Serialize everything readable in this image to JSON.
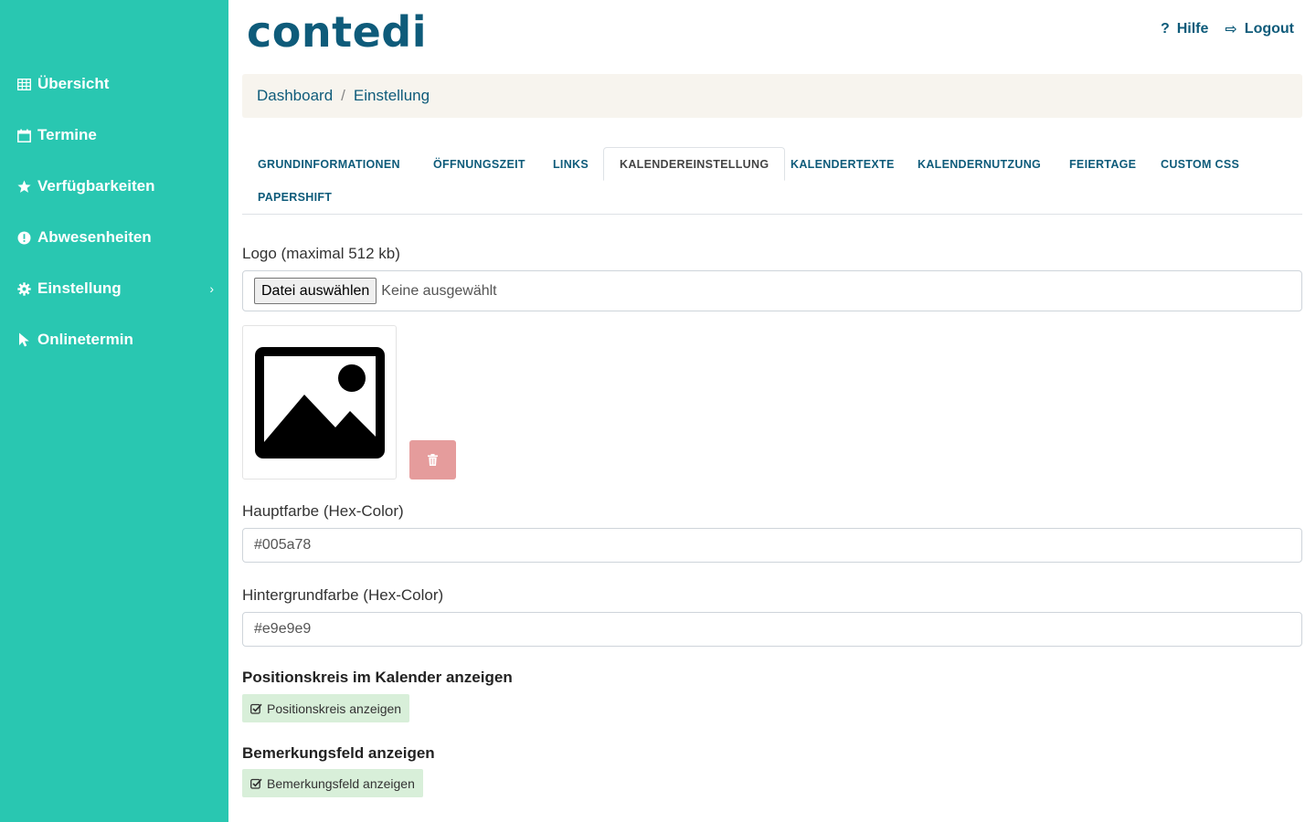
{
  "sidebar": {
    "items": [
      {
        "label": "Übersicht",
        "icon": "table-icon"
      },
      {
        "label": "Termine",
        "icon": "calendar-icon"
      },
      {
        "label": "Verfügbarkeiten",
        "icon": "star-icon"
      },
      {
        "label": "Abwesenheiten",
        "icon": "exclamation-circle-icon"
      },
      {
        "label": "Einstellung",
        "icon": "gear-icon",
        "chevron": "›"
      },
      {
        "label": "Onlinetermin",
        "icon": "cursor-icon"
      }
    ]
  },
  "header": {
    "logo": "contedi",
    "help_label": "Hilfe",
    "logout_label": "Logout",
    "help_glyph": "?",
    "logout_glyph": "⇨"
  },
  "breadcrumb": {
    "items": [
      "Dashboard",
      "Einstellung"
    ],
    "separator": "/"
  },
  "tabs": [
    "GRUNDINFORMATIONEN",
    "ÖFFNUNGSZEIT",
    "LINKS",
    "KALENDEREINSTELLUNG",
    "KALENDERTEXTE",
    "KALENDERNUTZUNG",
    "FEIERTAGE",
    "CUSTOM CSS",
    "PAPERSHIFT"
  ],
  "active_tab": "KALENDEREINSTELLUNG",
  "form": {
    "logo_label": "Logo (maximal 512 kb)",
    "file_button": "Datei auswählen",
    "file_status": "Keine ausgewählt",
    "main_color_label": "Hauptfarbe (Hex-Color)",
    "main_color_value": "#005a78",
    "bg_color_label": "Hintergrundfarbe (Hex-Color)",
    "bg_color_value": "#e9e9e9",
    "position_heading": "Positionskreis im Kalender anzeigen",
    "position_checkbox": "Positionskreis anzeigen",
    "remark_heading": "Bemerkungsfeld anzeigen",
    "remark_checkbox": "Bemerkungsfeld anzeigen"
  },
  "colors": {
    "sidebar": "#29c7b1",
    "brand": "#0e5b7a",
    "delete": "#e59c9c",
    "checkbox_bg": "#d8efd9"
  }
}
